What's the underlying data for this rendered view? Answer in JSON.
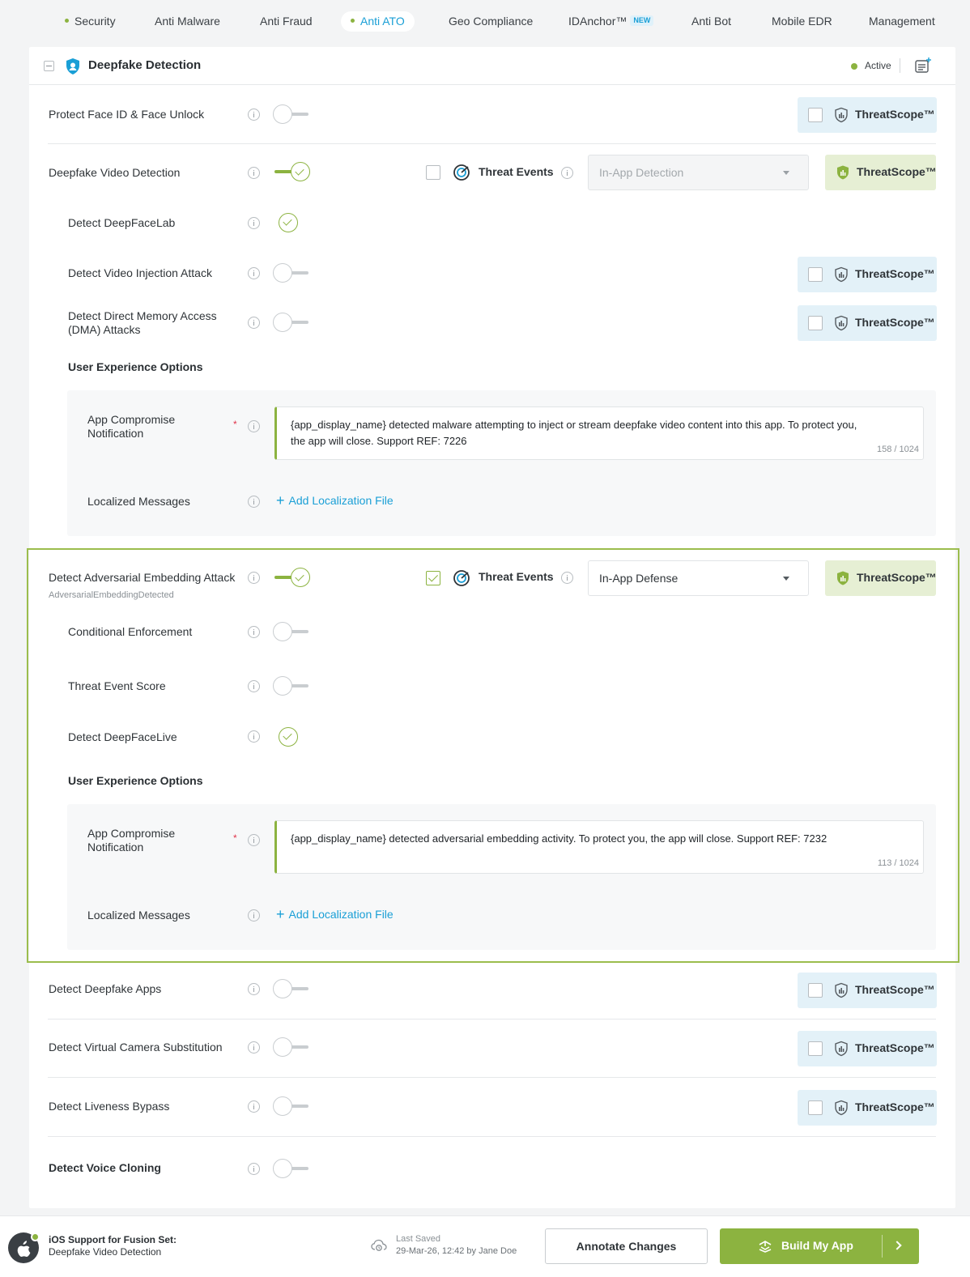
{
  "nav": {
    "tabs": [
      {
        "label": "Security",
        "dot": true
      },
      {
        "label": "Anti Malware"
      },
      {
        "label": "Anti Fraud"
      },
      {
        "label": "Anti ATO",
        "dot": true,
        "active": true
      },
      {
        "label": "Geo Compliance"
      },
      {
        "label": "IDAnchor™",
        "badge": "NEW"
      },
      {
        "label": "Anti Bot"
      },
      {
        "label": "Mobile EDR"
      },
      {
        "label": "Management"
      }
    ]
  },
  "card": {
    "title": "Deepfake Detection",
    "status": "Active",
    "status_color": "#8cb340"
  },
  "threatscope_label": "ThreatScope™",
  "threat_events_label": "Threat Events",
  "rows": {
    "face_id": {
      "label": "Protect Face ID & Face Unlock",
      "enabled": false
    },
    "deepfake_video": {
      "label": "Deepfake Video Detection",
      "enabled": true,
      "threat_events_checked": false,
      "response": "In-App Detection",
      "response_disabled": true
    },
    "deepfacelab": {
      "label": "Detect DeepFaceLab",
      "checked": true
    },
    "video_injection": {
      "label": "Detect Video Injection Attack",
      "enabled": false
    },
    "dma": {
      "label_line1": "Detect Direct Memory Access",
      "label_line2": "(DMA) Attacks",
      "enabled": false
    },
    "ux1": {
      "header": "User Experience Options",
      "notification_label_line1": "App Compromise",
      "notification_label_line2": "Notification",
      "required_mark": "*",
      "message": "{app_display_name} detected malware attempting to inject or stream deepfake video content into this app. To protect you, the app will close. Support REF: 7226",
      "counter": "158 / 1024",
      "localized_label": "Localized Messages",
      "add_localization": "Add Localization File"
    },
    "adversarial": {
      "label": "Detect Adversarial Embedding Attack",
      "sublabel": "AdversarialEmbeddingDetected",
      "enabled": true,
      "threat_events_checked": true,
      "response": "In-App Defense"
    },
    "conditional": {
      "label": "Conditional Enforcement",
      "enabled": false
    },
    "score": {
      "label": "Threat Event Score",
      "enabled": false
    },
    "deepfacelive": {
      "label": "Detect DeepFaceLive",
      "checked": true
    },
    "ux2": {
      "header": "User Experience Options",
      "notification_label_line1": "App Compromise",
      "notification_label_line2": "Notification",
      "required_mark": "*",
      "message": "{app_display_name} detected adversarial embedding activity. To protect you, the app will close. Support REF: 7232",
      "counter": "113 / 1024",
      "localized_label": "Localized Messages",
      "add_localization": "Add Localization File"
    },
    "deepfake_apps": {
      "label": "Detect Deepfake Apps",
      "enabled": false
    },
    "virtual_camera": {
      "label": "Detect Virtual Camera Substitution",
      "enabled": false
    },
    "liveness": {
      "label": "Detect Liveness Bypass",
      "enabled": false
    },
    "voice_cloning": {
      "label": "Detect Voice Cloning",
      "enabled": false
    }
  },
  "footer": {
    "platform_line1": "iOS Support for Fusion Set:",
    "platform_line2": "Deepfake Video Detection",
    "last_saved_label": "Last Saved",
    "last_saved_value": "29-Mar-26, 12:42 by Jane Doe",
    "annotate_button": "Annotate Changes",
    "build_button": "Build My App"
  },
  "colors": {
    "accent_green": "#8cb340",
    "link_blue": "#1a9fd6",
    "threatscope_bg": "#e3f1f8",
    "threatscope_active_bg": "#e6efd4"
  }
}
